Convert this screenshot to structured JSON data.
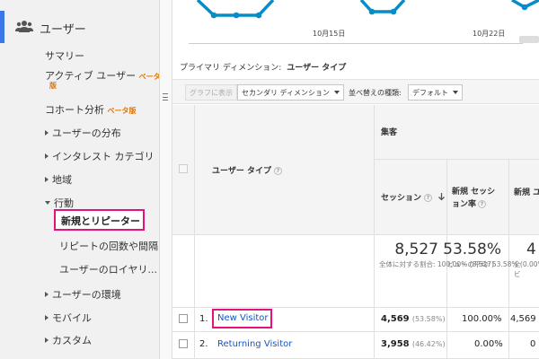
{
  "sidebar": {
    "title": "ユーザー",
    "items": [
      {
        "label": "サマリー"
      },
      {
        "label": "アクティブ ユーザー",
        "badge": "ベータ",
        "badge2": "版"
      },
      {
        "label": "コホート分析",
        "badge": "ベータ版"
      },
      {
        "label": "ユーザーの分布"
      },
      {
        "label": "インタレスト カテゴリ"
      },
      {
        "label": "地域"
      },
      {
        "label": "行動"
      },
      {
        "label": "新規とリピーター"
      },
      {
        "label": "リピートの回数や間隔"
      },
      {
        "label": "ユーザーのロイヤリ..."
      },
      {
        "label": "ユーザーの環境"
      },
      {
        "label": "モバイル"
      },
      {
        "label": "カスタム"
      }
    ]
  },
  "chart": {
    "x_ticks": [
      "10月15日",
      "10月22日"
    ],
    "line_color": "#058dc7"
  },
  "dimension": {
    "label": "プライマリ ディメンション:",
    "value": "ユーザー タイプ"
  },
  "toolbar": {
    "graph_button": "グラフに表示",
    "secondary_dimension": "セカンダリ ディメンション",
    "sort_label": "並べ替えの種類:",
    "sort_value": "デフォルト"
  },
  "table": {
    "group_header": "集客",
    "dimension_header": "ユーザー タイプ",
    "col_sessions": "セッション",
    "col_new_session_rate": "新規 セッション率",
    "col_new_users": "新規 ユ",
    "totals": {
      "sessions": "8,527",
      "sessions_note": "全体に対する割合: 100.00% (8,527)",
      "new_rate": "53.58%",
      "new_rate_note": "ビューの平均: 53.58% (0.00%)"
    },
    "rows": [
      {
        "index": "1.",
        "name": "New Visitor",
        "sessions": "4,569",
        "sessions_pct": "(53.58%)",
        "new_rate": "100.00%",
        "new_users": "4,569"
      },
      {
        "index": "2.",
        "name": "Returning Visitor",
        "sessions": "3,958",
        "sessions_pct": "(46.42%)",
        "new_rate": "0.00%",
        "new_users": "0"
      }
    ],
    "help_icon": "question-mark-circle-icon",
    "sort_icon": "sort-down-arrow-icon"
  },
  "colors": {
    "accent": "#3b78e7",
    "highlight": "#e3127c",
    "link": "#1155cc",
    "beta": "#e37400"
  }
}
